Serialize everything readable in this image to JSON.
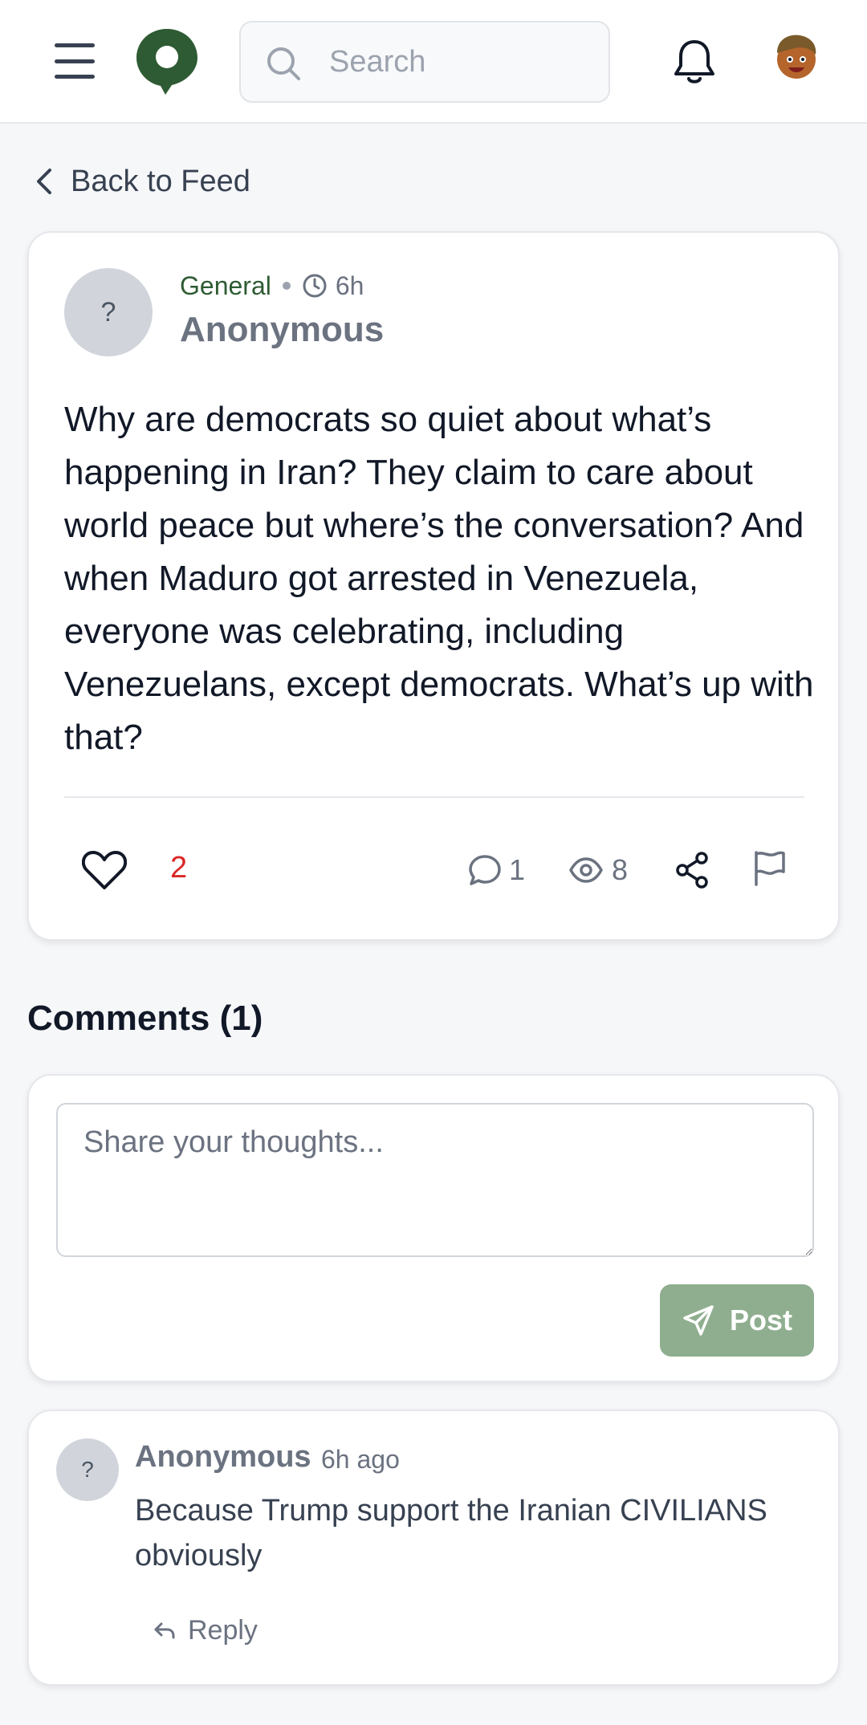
{
  "header": {
    "search_placeholder": "Search",
    "icons": [
      "menu-icon",
      "logo-pin-icon",
      "search-icon",
      "bell-icon",
      "user-avatar"
    ],
    "brand_color": "#2e5b33"
  },
  "back": {
    "label": "Back to Feed"
  },
  "post": {
    "avatar_glyph": "?",
    "category": "General",
    "time": "6h",
    "author": "Anonymous",
    "body": "Why are democrats so quiet about what’s happening in Iran? They claim to care about world peace but where’s the conversation? And when Maduro got arrested in Venezuela, everyone was celebrating, including Venezuelans, except democrats. What’s up with that?",
    "likes": "2",
    "comments": "1",
    "views": "8",
    "like_color": "#dc2626"
  },
  "comments_section": {
    "heading": "Comments (1)",
    "compose_placeholder": "Share your thoughts...",
    "post_button_label": "Post",
    "post_button_color": "#8fae8f"
  },
  "comments": [
    {
      "avatar_glyph": "?",
      "author": "Anonymous",
      "time": "6h ago",
      "text": "Because Trump support the Iranian CIVILIANS obviously",
      "reply_label": "Reply"
    }
  ]
}
